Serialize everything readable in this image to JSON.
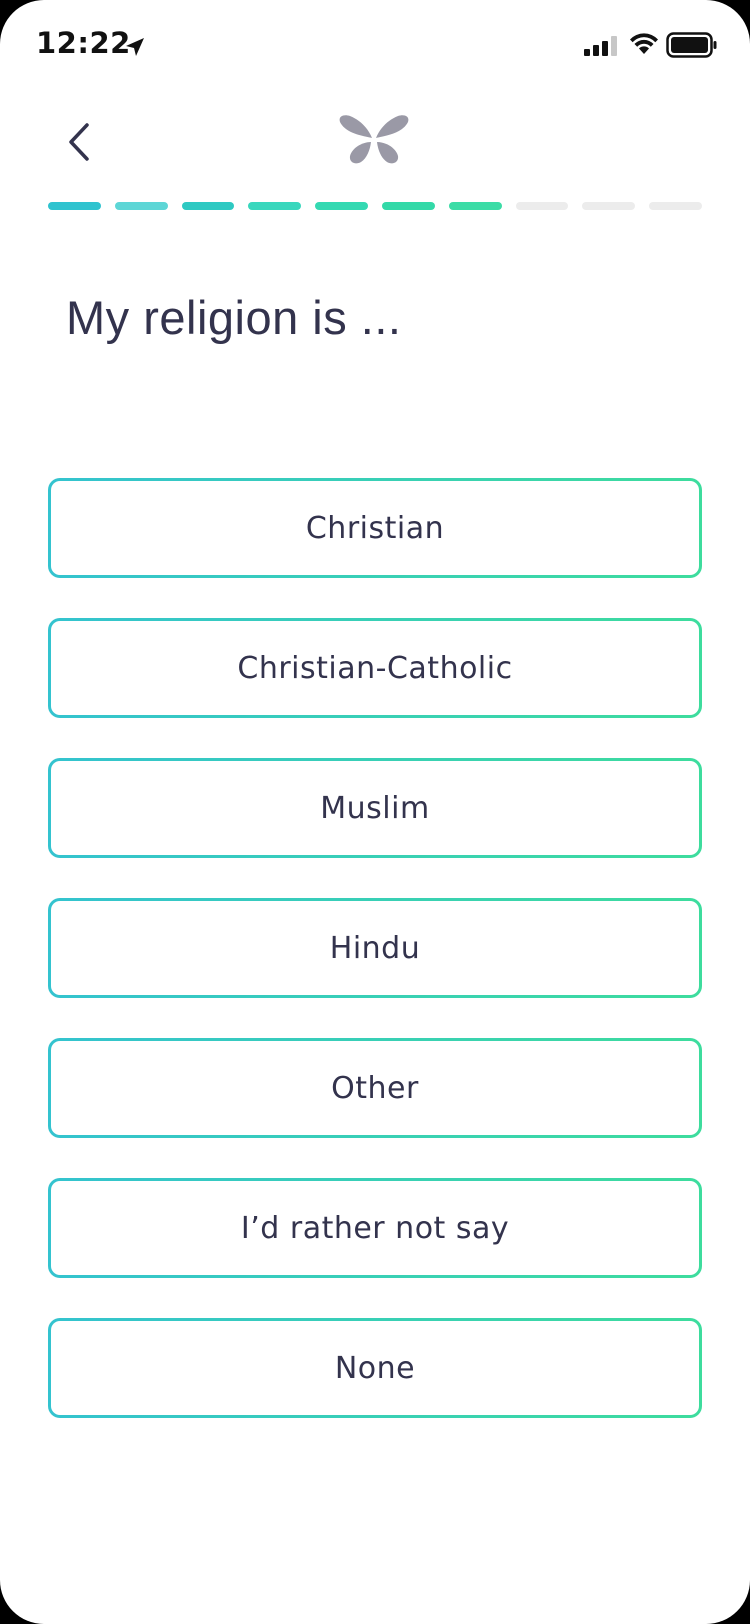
{
  "status_bar": {
    "time": "12:22"
  },
  "header": {
    "back_icon": "chevron-left-icon",
    "logo_icon": "butterfly-logo-icon"
  },
  "progress": {
    "completed_steps": 7,
    "total_steps": 10,
    "completed_colors": [
      "#2fc3cf",
      "#5dd6d6",
      "#2ec9c2",
      "#39d7bd",
      "#34d9b2",
      "#33d9a8",
      "#3bdca6"
    ],
    "remaining_color": "#ececec"
  },
  "title": "My religion is ...",
  "options": [
    {
      "label": "Christian"
    },
    {
      "label": "Christian-Catholic"
    },
    {
      "label": "Muslim"
    },
    {
      "label": "Hindu"
    },
    {
      "label": "Other"
    },
    {
      "label": "I’d rather not say"
    },
    {
      "label": "None"
    }
  ],
  "colors": {
    "text": "#33334d",
    "gradient_start": "#34c3cf",
    "gradient_end": "#3ddc9d",
    "logo": "#9a99a6"
  }
}
